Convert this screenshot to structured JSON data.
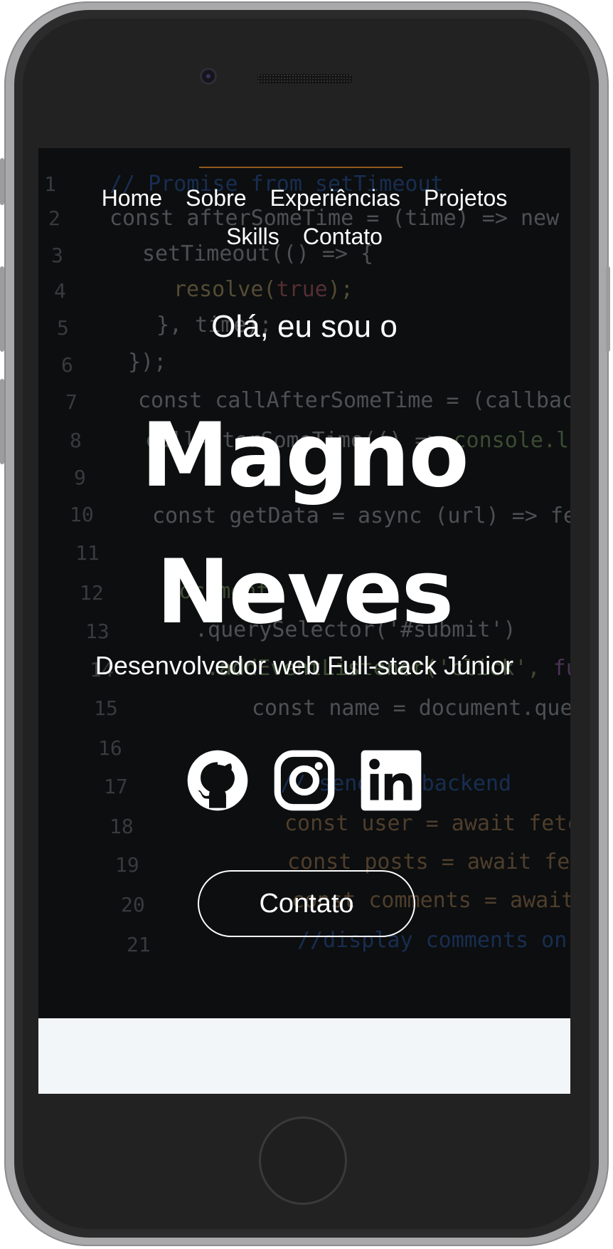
{
  "nav": {
    "items": [
      {
        "label": "Home"
      },
      {
        "label": "Sobre"
      },
      {
        "label": "Experiências"
      },
      {
        "label": "Projetos"
      },
      {
        "label": "Skills"
      },
      {
        "label": "Contato"
      }
    ]
  },
  "hero": {
    "greeting": "Olá, eu sou o",
    "first_name": "Magno",
    "last_name": "Neves",
    "role": "Desenvolvedor web Full-stack Júnior",
    "cta_label": "Contato"
  },
  "socials": [
    {
      "icon": "github-icon"
    },
    {
      "icon": "instagram-icon"
    },
    {
      "icon": "linkedin-icon"
    }
  ],
  "colors": {
    "hero_background": "#0c0e0f",
    "text": "#ffffff",
    "section_background": "#f3f6f9",
    "phone_frame": "#2b2b2c"
  }
}
